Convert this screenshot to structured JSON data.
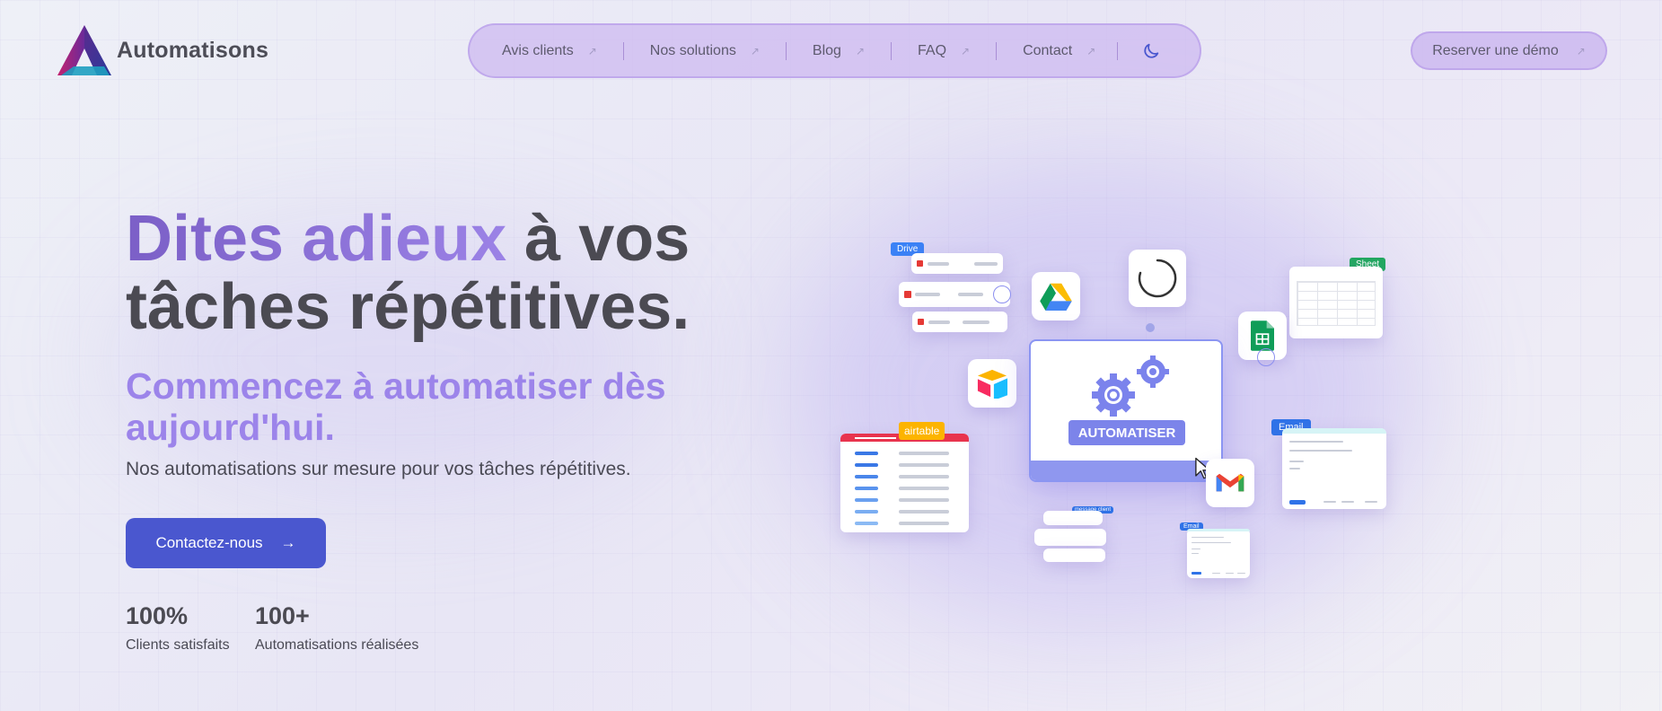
{
  "brand": {
    "name": "Automatisons"
  },
  "nav": {
    "items": [
      {
        "label": "Avis clients"
      },
      {
        "label": "Nos solutions"
      },
      {
        "label": "Blog"
      },
      {
        "label": "FAQ"
      },
      {
        "label": "Contact"
      }
    ],
    "arrow_glyph": "↗",
    "theme_icon": "moon-icon"
  },
  "header_cta": {
    "label": "Reserver une démo",
    "arrow_glyph": "↗"
  },
  "hero": {
    "title_highlight": "Dites adieux",
    "title_rest_1": " à vos",
    "title_rest_2": "tâches répétitives.",
    "subtitle": "Commencez à automatiser dès aujourd'hui.",
    "description": "Nos automatisations sur mesure pour vos tâches répétitives.",
    "cta_label": "Contactez-nous",
    "cta_arrow": "→"
  },
  "stats": [
    {
      "value": "100%",
      "label": "Clients satisfaits"
    },
    {
      "value": "100+",
      "label": "Automatisations réalisées"
    }
  ],
  "illustration": {
    "main_label": "AUTOMATISER",
    "tags": {
      "drive": "Drive",
      "sheet": "Sheet",
      "email_main": "Email",
      "email_small": "Email",
      "airtable": "airtable",
      "message": "message client"
    }
  },
  "colors": {
    "accent": "#4a57cf",
    "gradient_start": "#7b5fc7",
    "gradient_end": "#9b82e6",
    "subtitle": "#9c84ea",
    "nav_bg": "#cdb9f0"
  }
}
